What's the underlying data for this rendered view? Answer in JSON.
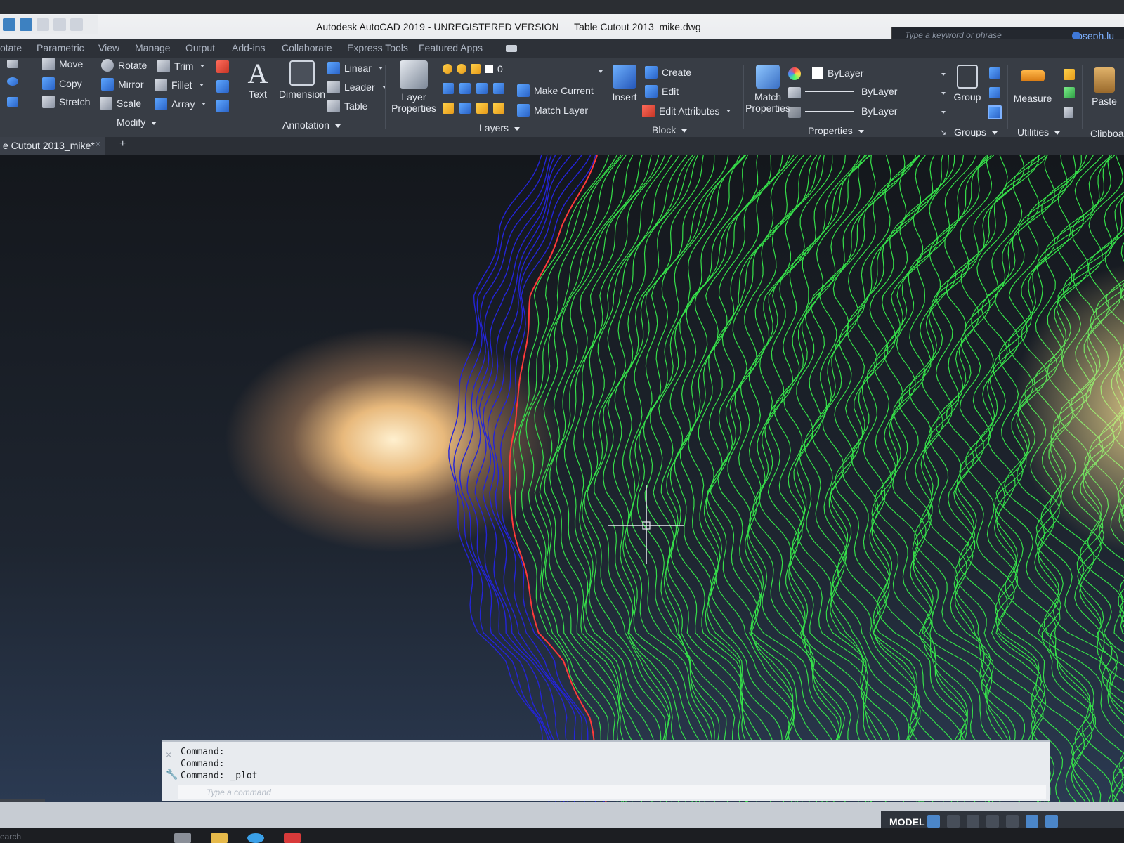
{
  "titlebar": {
    "app_name": "Autodesk AutoCAD 2019 - UNREGISTERED VERSION",
    "document_name": "Table Cutout 2013_mike.dwg",
    "search_placeholder": "Type a keyword or phrase",
    "user": "joseph.lu"
  },
  "menu_tabs": [
    "otate",
    "Parametric",
    "View",
    "Manage",
    "Output",
    "Add-ins",
    "Collaborate",
    "Express Tools",
    "Featured Apps"
  ],
  "ribbon": {
    "modify": {
      "panel_label": "Modify",
      "move": "Move",
      "rotate": "Rotate",
      "trim": "Trim",
      "copy": "Copy",
      "mirror": "Mirror",
      "fillet": "Fillet",
      "stretch": "Stretch",
      "scale": "Scale",
      "array": "Array"
    },
    "annotation": {
      "panel_label": "Annotation",
      "text": "Text",
      "dimension": "Dimension",
      "linear": "Linear",
      "leader": "Leader",
      "table": "Table"
    },
    "layers": {
      "panel_label": "Layers",
      "layer_properties_1": "Layer",
      "layer_properties_2": "Properties",
      "current_layer": "0",
      "make_current": "Make Current",
      "match_layer": "Match Layer"
    },
    "block": {
      "panel_label": "Block",
      "insert": "Insert",
      "create": "Create",
      "edit": "Edit",
      "edit_attributes": "Edit Attributes"
    },
    "properties": {
      "panel_label": "Properties",
      "match_properties_1": "Match",
      "match_properties_2": "Properties",
      "color": "ByLayer",
      "linetype": "ByLayer",
      "lineweight": "ByLayer"
    },
    "groups": {
      "panel_label": "Groups",
      "group": "Group"
    },
    "utilities": {
      "panel_label": "Utilities",
      "measure": "Measure"
    },
    "clipboard": {
      "panel_label": "Clipboa",
      "paste": "Paste"
    }
  },
  "file_tab": {
    "label": "e Cutout 2013_mike*",
    "close": "×",
    "new_tab": "+"
  },
  "command_window": {
    "lines": [
      "Command:",
      "Command:",
      "Command: _plot"
    ],
    "input_placeholder": "Type a command",
    "close": "×",
    "wrench": "🔧"
  },
  "statusbar": {
    "model": "MODEL"
  },
  "taskbar": {
    "search": "earch"
  },
  "colors": {
    "ribbon_bg": "#383d45",
    "contour_blue": "#2424d8",
    "contour_green": "#36e04a",
    "boundary_red": "#ff3a3a",
    "accent_blue": "#4f8fd8"
  },
  "icons": {
    "move": "move-arrows-icon",
    "rotate": "rotate-icon",
    "trim": "trim-icon",
    "copy": "copy-icon",
    "mirror": "mirror-icon",
    "fillet": "fillet-icon",
    "stretch": "stretch-icon",
    "scale": "scale-icon",
    "array": "array-icon",
    "text": "text-A-icon",
    "dimension": "dimension-icon",
    "insert": "insert-block-icon",
    "group": "group-icon",
    "measure": "ruler-icon",
    "paste": "clipboard-icon"
  }
}
